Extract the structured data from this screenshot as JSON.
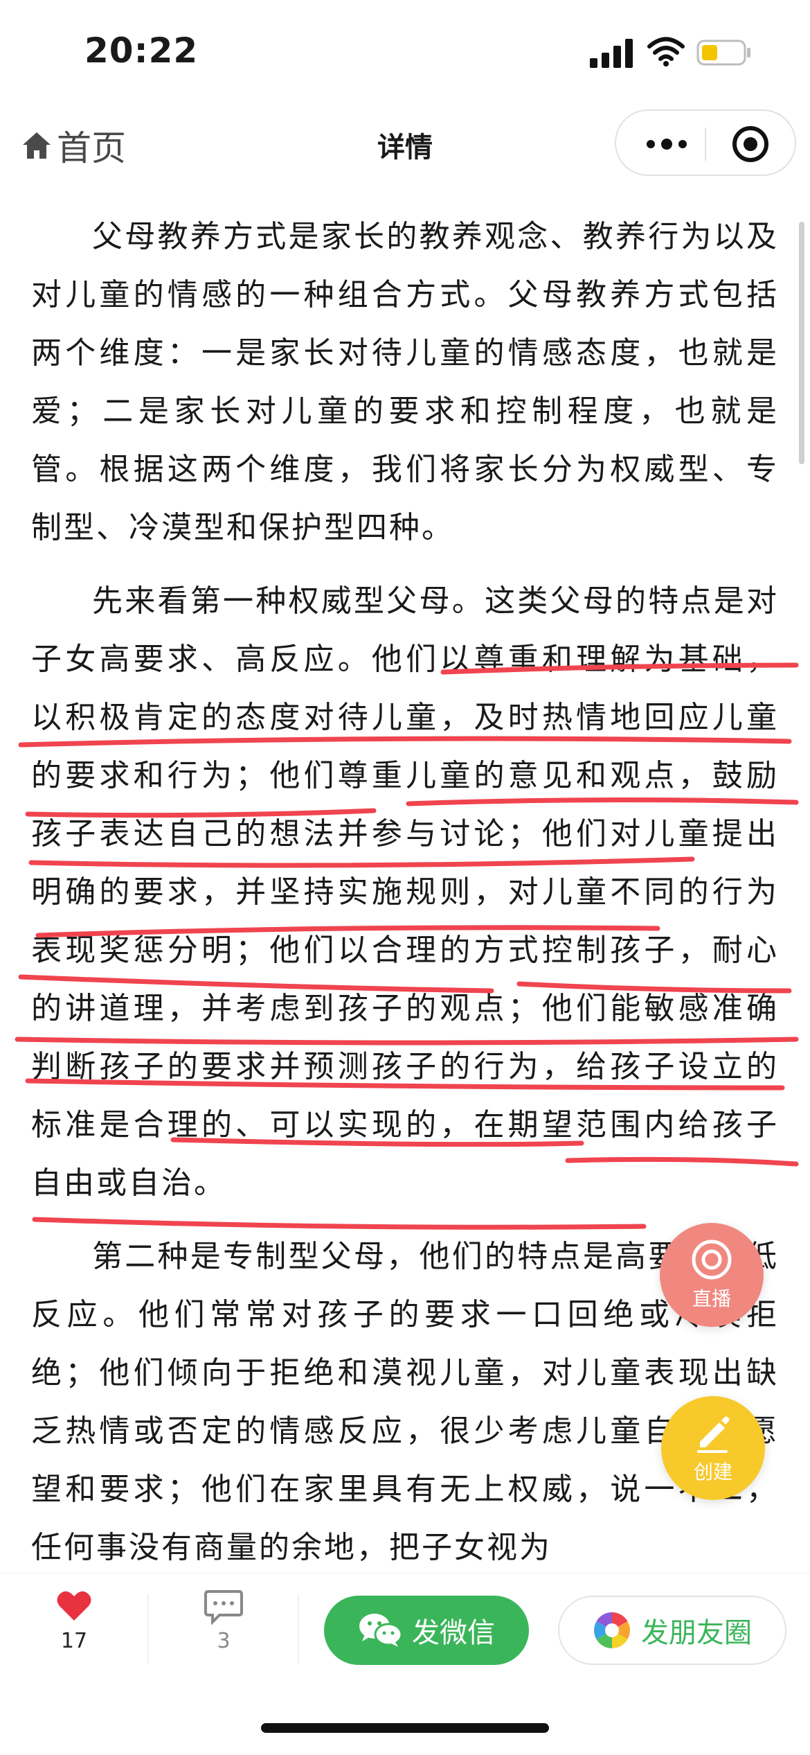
{
  "status_bar": {
    "time": "20:22"
  },
  "nav": {
    "home_label": "首页",
    "title": "详情"
  },
  "article": {
    "paragraphs": [
      "父母教养方式是家长的教养观念、教养行为以及对儿童的情感的一种组合方式。父母教养方式包括两个维度：一是家长对待儿童的情感态度，也就是爱；二是家长对儿童的要求和控制程度，也就是管。根据这两个维度，我们将家长分为权威型、专制型、冷漠型和保护型四种。",
      "先来看第一种权威型父母。这类父母的特点是对子女高要求、高反应。他们以尊重和理解为基础，以积极肯定的态度对待儿童，及时热情地回应儿童的要求和行为；他们尊重儿童的意见和观点，鼓励孩子表达自己的想法并参与讨论；他们对儿童提出明确的要求，并坚持实施规则，对儿童不同的行为表现奖惩分明；他们以合理的方式控制孩子，耐心的讲道理，并考虑到孩子的观点；他们能敏感准确判断孩子的要求并预测孩子的行为，给孩子设立的标准是合理的、可以实现的，在期望范围内给孩子自由或自治。",
      "第二种是专制型父母，他们的特点是高要求，低反应。他们常常对孩子的要求一口回绝或冷漠拒绝；他们倾向于拒绝和漠视儿童，对儿童表现出缺乏热情或否定的情感反应，很少考虑儿童自身的愿望和要求；他们在家里具有无上权威，说一不二，任何事没有商量的余地，把子女视为"
    ]
  },
  "fabs": {
    "live_label": "直播",
    "create_label": "创建"
  },
  "bottom_bar": {
    "like_count": "17",
    "comment_count": "3",
    "wechat_label": "发微信",
    "moments_label": "发朋友圈"
  },
  "colors": {
    "underline": "#f0444f",
    "wechat_green": "#3bb55a",
    "live_fab": "#f08880",
    "create_fab": "#f7c92b",
    "like_red": "#e8323f"
  },
  "icons": [
    "home-icon",
    "more-icon",
    "target-icon",
    "live-icon",
    "edit-icon",
    "heart-icon",
    "comment-icon",
    "wechat-icon",
    "moments-icon"
  ]
}
